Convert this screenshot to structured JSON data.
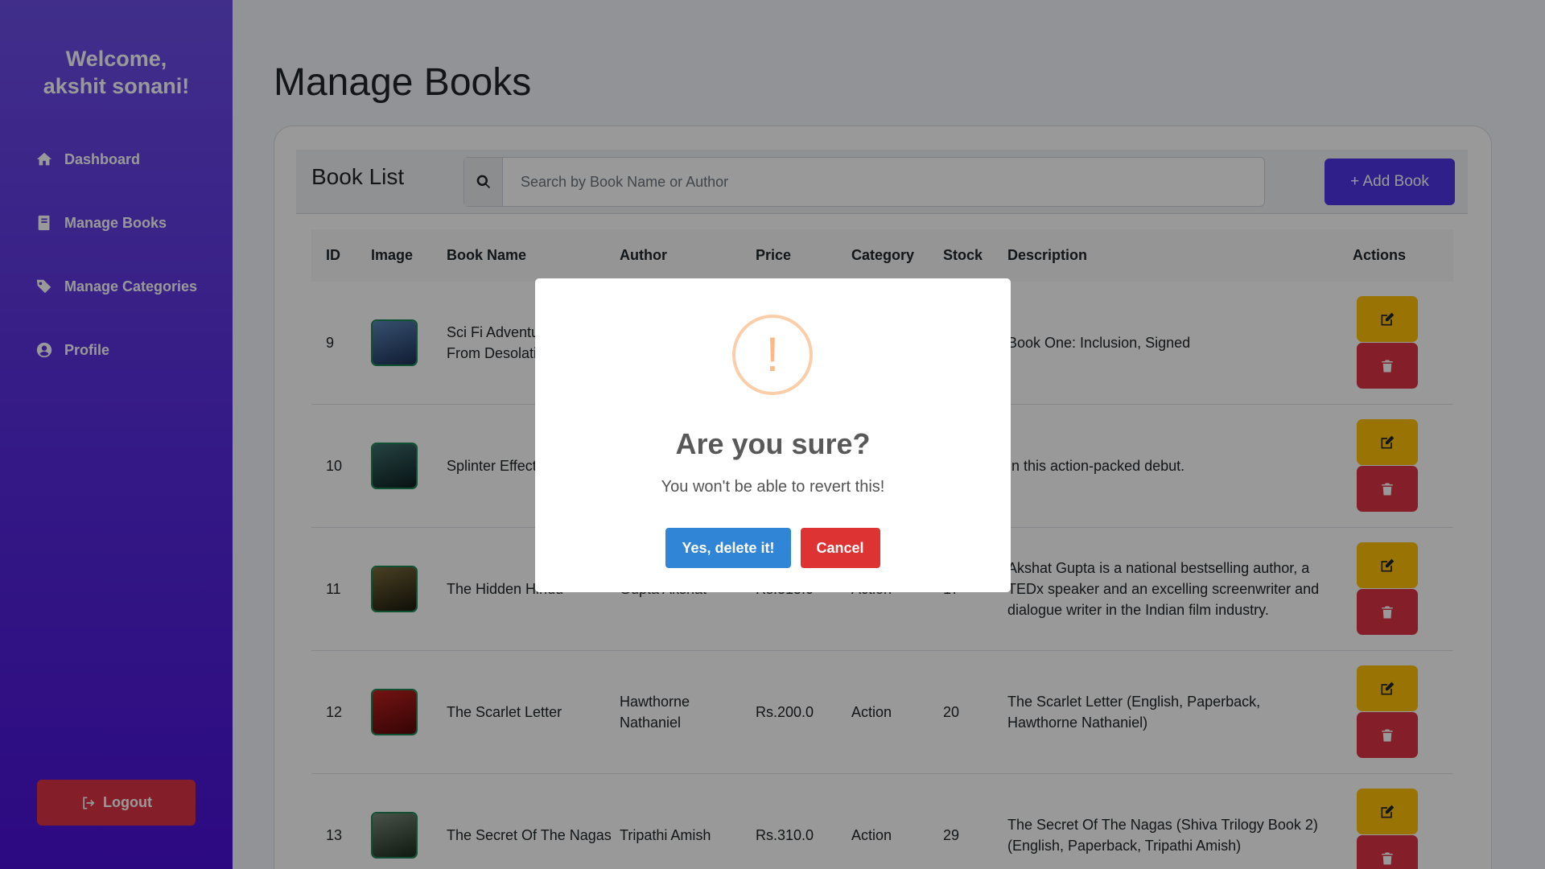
{
  "sidebar": {
    "welcome_line1": "Welcome,",
    "welcome_line2": "akshit sonani!",
    "items": [
      {
        "label": "Dashboard",
        "icon": "home-icon"
      },
      {
        "label": "Manage Books",
        "icon": "book-icon"
      },
      {
        "label": "Manage Categories",
        "icon": "tags-icon"
      },
      {
        "label": "Profile",
        "icon": "user-circle-icon"
      }
    ],
    "logout_label": "Logout"
  },
  "main": {
    "title": "Manage Books",
    "card_title": "Book List",
    "search_placeholder": "Search by Book Name or Author",
    "add_button_label": "+ Add Book"
  },
  "table": {
    "headers": [
      "ID",
      "Image",
      "Book Name",
      "Author",
      "Price",
      "Category",
      "Stock",
      "Description",
      "Actions"
    ],
    "rows": [
      {
        "id": "9",
        "book_name": "Sci Fi Adventure: Escape From Desolation",
        "author": "",
        "price": "",
        "category": "",
        "stock": "",
        "description": "Book One: Inclusion, Signed",
        "cover_color": "#2a4a7a"
      },
      {
        "id": "10",
        "book_name": "Splinter Effect",
        "author": "",
        "price": "",
        "category": "",
        "stock": "",
        "description": "In this action-packed debut.",
        "cover_color": "#1e3a3a"
      },
      {
        "id": "11",
        "book_name": "The Hidden Hindu",
        "author": "Gupta Akshat",
        "price": "Rs.315.0",
        "category": "Action",
        "stock": "17",
        "description": "Akshat Gupta is a national bestselling author, a TEDx speaker and an excelling screenwriter and dialogue writer in the Indian film industry.",
        "cover_color": "#3a3a1e"
      },
      {
        "id": "12",
        "book_name": "The Scarlet Letter",
        "author": "Hawthorne Nathaniel",
        "price": "Rs.200.0",
        "category": "Action",
        "stock": "20",
        "description": "The Scarlet Letter (English, Paperback, Hawthorne Nathaniel)",
        "cover_color": "#a01818"
      },
      {
        "id": "13",
        "book_name": "The Secret Of The Nagas",
        "author": "Tripathi Amish",
        "price": "Rs.310.0",
        "category": "Action",
        "stock": "29",
        "description": "The Secret Of The Nagas (Shiva Trilogy Book 2) (English, Paperback, Tripathi Amish)",
        "cover_color": "#4a5a4a"
      }
    ]
  },
  "modal": {
    "icon_glyph": "!",
    "title": "Are you sure?",
    "text": "You won't be able to revert this!",
    "confirm_label": "Yes, delete it!",
    "cancel_label": "Cancel"
  },
  "colors": {
    "sidebar_top": "#6d4ee8",
    "sidebar_bottom": "#4a10d8",
    "accent": "#4f34e6",
    "edit": "#ffc107",
    "delete": "#dc3545",
    "confirm": "#3085d6",
    "cancel": "#dd3333"
  }
}
